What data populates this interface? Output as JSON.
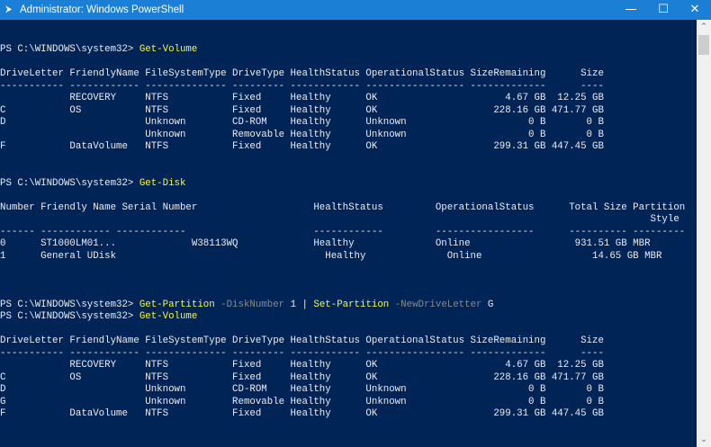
{
  "window": {
    "title": "Administrator: Windows PowerShell",
    "icons": {
      "app": "powershell-icon",
      "minimize": "minimize-icon",
      "maximize": "maximize-icon",
      "close": "close-icon"
    },
    "glyphs": {
      "app": "⮞",
      "minimize": "—",
      "maximize": "☐",
      "close": "✕",
      "up": "⌃",
      "down": "⌄"
    }
  },
  "colors": {
    "background": "#012456",
    "text": "#eeedf0",
    "command": "#f7f74a",
    "parameter": "#8a8a8a",
    "titlebar": "#1b7fd6"
  },
  "terminal": {
    "lines": [
      [],
      [
        [
          "PS C:\\WINDOWS\\system32> ",
          "out"
        ],
        [
          "Get-Volume",
          "cmd"
        ]
      ],
      [],
      [
        [
          "DriveLetter FriendlyName FileSystemType DriveType HealthStatus OperationalStatus SizeRemaining      Size",
          "out"
        ]
      ],
      [
        [
          "----------- ------------ -------------- --------- ------------ ----------------- -------------      ----",
          "out"
        ]
      ],
      [
        [
          "            RECOVERY     NTFS           Fixed     Healthy      OK                      4.67 GB  12.25 GB",
          "out"
        ]
      ],
      [
        [
          "C           OS           NTFS           Fixed     Healthy      OK                    228.16 GB 471.77 GB",
          "out"
        ]
      ],
      [
        [
          "D                        Unknown        CD-ROM    Healthy      Unknown                     0 B       0 B",
          "out"
        ]
      ],
      [
        [
          "                         Unknown        Removable Healthy      Unknown                     0 B       0 B",
          "out"
        ]
      ],
      [
        [
          "F           DataVolume   NTFS           Fixed     Healthy      OK                    299.31 GB 447.45 GB",
          "out"
        ]
      ],
      [],
      [],
      [
        [
          "PS C:\\WINDOWS\\system32> ",
          "out"
        ],
        [
          "Get-Disk",
          "cmd"
        ]
      ],
      [],
      [
        [
          "Number Friendly Name Serial Number                    HealthStatus         OperationalStatus      Total Size Partition",
          "out"
        ]
      ],
      [
        [
          "                                                                                                                Style",
          "out"
        ]
      ],
      [
        [
          "------ ------------ ------------                      ------------         -----------------      ---------- ---------",
          "out"
        ]
      ],
      [
        [
          "0      ST1000LM01...             W38113WQ             Healthy              Online                  931.51 GB MBR",
          "out"
        ]
      ],
      [
        [
          "1      General UDisk                                    Healthy              Online                   14.65 GB MBR",
          "out"
        ]
      ],
      [],
      [],
      [],
      [
        [
          "PS C:\\WINDOWS\\system32> ",
          "out"
        ],
        [
          "Get-Partition",
          "cmd"
        ],
        [
          " -DiskNumber",
          "par"
        ],
        [
          " 1 | ",
          "out"
        ],
        [
          "Set-Partition",
          "cmd"
        ],
        [
          " -NewDriveLetter",
          "par"
        ],
        [
          " G",
          "out"
        ]
      ],
      [
        [
          "PS C:\\WINDOWS\\system32> ",
          "out"
        ],
        [
          "Get-Volume",
          "cmd"
        ]
      ],
      [],
      [
        [
          "DriveLetter FriendlyName FileSystemType DriveType HealthStatus OperationalStatus SizeRemaining      Size",
          "out"
        ]
      ],
      [
        [
          "----------- ------------ -------------- --------- ------------ ----------------- -------------      ----",
          "out"
        ]
      ],
      [
        [
          "            RECOVERY     NTFS           Fixed     Healthy      OK                      4.67 GB  12.25 GB",
          "out"
        ]
      ],
      [
        [
          "C           OS           NTFS           Fixed     Healthy      OK                    228.16 GB 471.77 GB",
          "out"
        ]
      ],
      [
        [
          "D                        Unknown        CD-ROM    Healthy      Unknown                     0 B       0 B",
          "out"
        ]
      ],
      [
        [
          "G                        Unknown        Removable Healthy      Unknown                     0 B       0 B",
          "out"
        ]
      ],
      [
        [
          "F           DataVolume   NTFS           Fixed     Healthy      OK                    299.31 GB 447.45 GB",
          "out"
        ]
      ]
    ]
  }
}
